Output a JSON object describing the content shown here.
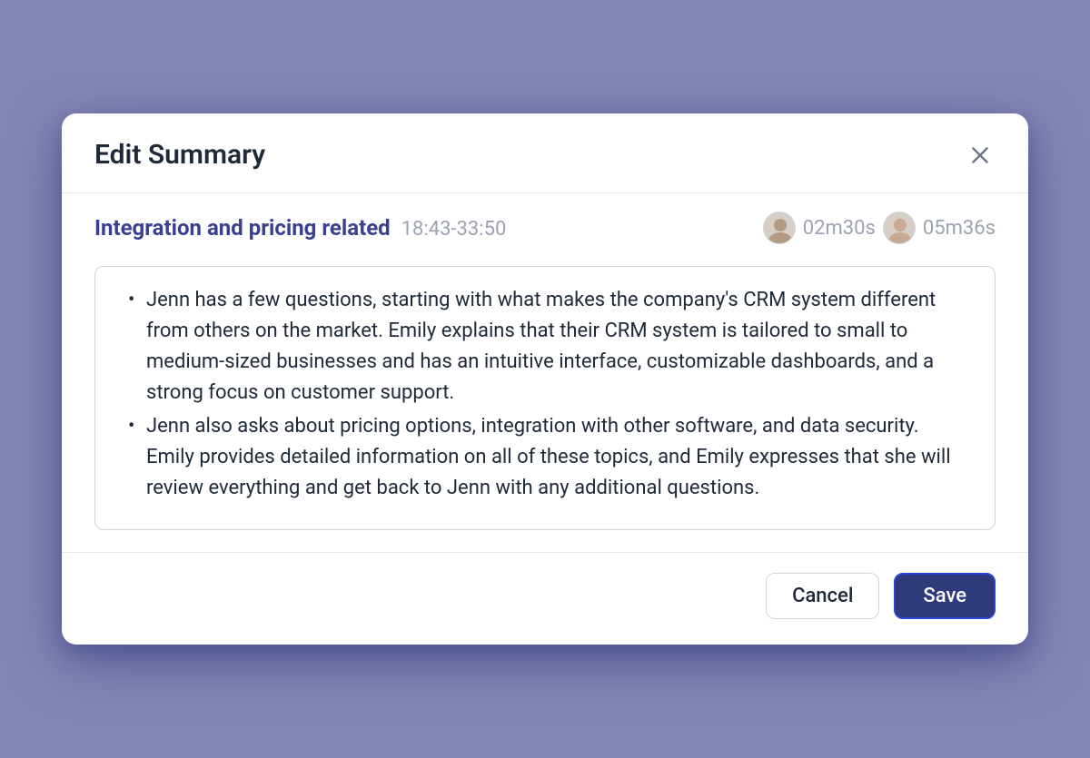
{
  "modal": {
    "title": "Edit Summary",
    "topic": "Integration and pricing related",
    "time_range": "18:43-33:50",
    "participants": [
      {
        "duration": "02m30s"
      },
      {
        "duration": "05m36s"
      }
    ],
    "bullets": [
      "Jenn has a few questions, starting with what makes the company's CRM system different from others on the market. Emily explains that their CRM system is tailored to small to medium-sized businesses and has an intuitive interface, customizable dashboards, and a strong focus on customer support.",
      "Jenn also asks about pricing options, integration with other software, and data security. Emily provides detailed information on all of these topics, and Emily expresses that she will review everything and get back to Jenn with any additional questions."
    ],
    "buttons": {
      "cancel": "Cancel",
      "save": "Save"
    }
  }
}
